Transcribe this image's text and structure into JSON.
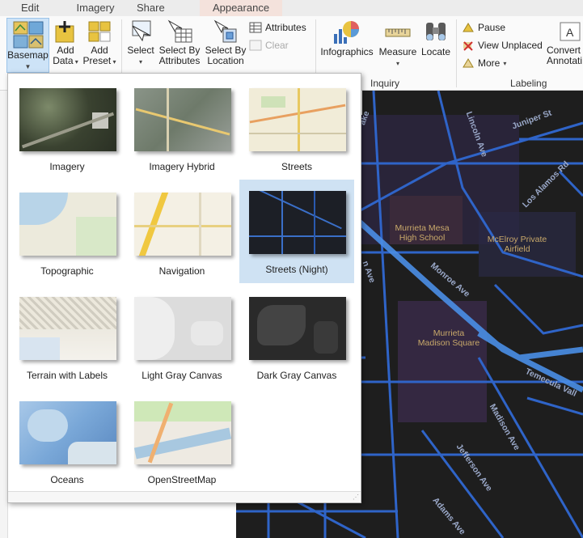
{
  "tabs": [
    "Edit",
    "Imagery",
    "Share",
    "Appearance"
  ],
  "ribbon": {
    "basemap": "Basemap",
    "add_data": [
      "Add",
      "Data"
    ],
    "add_preset": [
      "Add",
      "Preset"
    ],
    "select": "Select",
    "select_by_attributes": [
      "Select By",
      "Attributes"
    ],
    "select_by_location": [
      "Select By",
      "Location"
    ],
    "attributes": "Attributes",
    "clear": "Clear",
    "infographics": "Infographics",
    "measure": "Measure",
    "locate": "Locate",
    "pause": "Pause",
    "view_unplaced": "View Unplaced",
    "more": "More",
    "convert": [
      "Convert",
      "Annotati"
    ],
    "group_inquiry": "Inquiry",
    "group_labeling": "Labeling"
  },
  "gallery": {
    "items": [
      {
        "label": "Imagery",
        "icon": "imagery-thumb"
      },
      {
        "label": "Imagery Hybrid",
        "icon": "imagery-hybrid-thumb"
      },
      {
        "label": "Streets",
        "icon": "streets-thumb"
      },
      {
        "label": "Topographic",
        "icon": "topographic-thumb"
      },
      {
        "label": "Navigation",
        "icon": "navigation-thumb"
      },
      {
        "label": "Streets (Night)",
        "icon": "streets-night-thumb",
        "selected": true
      },
      {
        "label": "Terrain with Labels",
        "icon": "terrain-thumb"
      },
      {
        "label": "Light Gray Canvas",
        "icon": "light-gray-thumb"
      },
      {
        "label": "Dark Gray Canvas",
        "icon": "dark-gray-thumb"
      },
      {
        "label": "Oceans",
        "icon": "oceans-thumb"
      },
      {
        "label": "OpenStreetMap",
        "icon": "osm-thumb"
      }
    ]
  },
  "map": {
    "streets": [
      "Lincoln Ave",
      "Juniper St",
      "Los Alamos Rd",
      "Monroe Ave",
      "Temecula Vall",
      "Madison Ave",
      "Jefferson Ave",
      "Adams Ave"
    ],
    "pois": [
      [
        "Murrieta Mesa",
        "High School"
      ],
      [
        "McElroy Private",
        "Airfield"
      ],
      [
        "Murrieta",
        "Madison Square"
      ]
    ],
    "partial_labels": [
      "ake",
      "n Ave",
      "t"
    ]
  },
  "colors": {
    "selected": "#cfe2f3",
    "map_bg": "#1e1e1e",
    "road": "#2f64c8",
    "highway": "#4a8ee6"
  }
}
